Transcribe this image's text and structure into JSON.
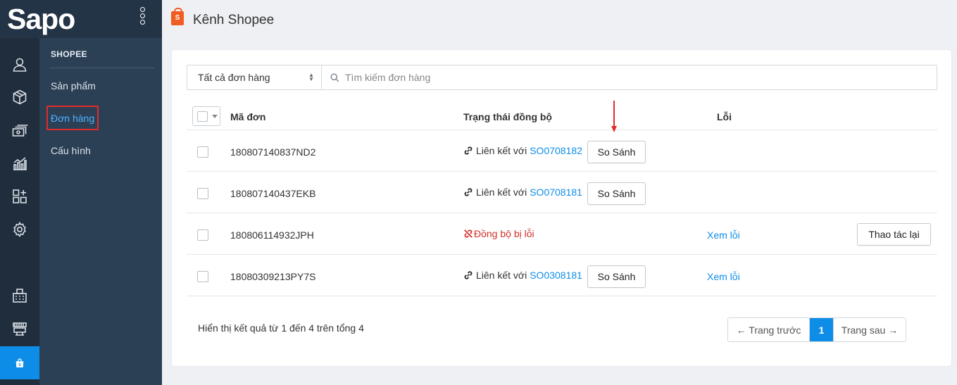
{
  "app": {
    "logo_text": "Sapo"
  },
  "sidebar": {
    "section_title": "SHOPEE",
    "items": [
      {
        "label": "Sản phẩm"
      },
      {
        "label": "Đơn hàng"
      },
      {
        "label": "Cấu hình"
      }
    ]
  },
  "rail": {
    "icons": [
      "user-icon",
      "box-icon",
      "money-icon",
      "chart-icon",
      "apps-icon",
      "gear-icon",
      "pos-register-icon",
      "store-icon",
      "shopee-bag-icon"
    ]
  },
  "header": {
    "title": "Kênh Shopee",
    "icon_glyph": "S"
  },
  "filter": {
    "select_value": "Tất cả đơn hàng",
    "search_placeholder": "Tìm kiếm đơn hàng"
  },
  "table": {
    "headers": {
      "code": "Mã đơn",
      "sync_status": "Trạng thái đồng bộ",
      "error": "Lỗi"
    },
    "link_prefix": "Liên kết với",
    "compare_label": "So Sánh",
    "view_error_label": "Xem lỗi",
    "retry_label": "Thao tác lại",
    "rows": [
      {
        "code": "180807140837ND2",
        "status": "linked",
        "linked_order": "SO0708182"
      },
      {
        "code": "180807140437EKB",
        "status": "linked",
        "linked_order": "SO0708181"
      },
      {
        "code": "180806114932JPH",
        "status": "error",
        "status_text": "Đồng bộ bị lỗi"
      },
      {
        "code": "18080309213PY7S",
        "status": "linked",
        "linked_order": "SO0308181"
      }
    ]
  },
  "footer": {
    "summary": "Hiển thị kết quả từ 1 đến 4 trên tổng 4",
    "prev_label": "← Trang trước",
    "current_page": "1",
    "next_label": "Trang sau →"
  },
  "colors": {
    "accent": "#0d8de8",
    "error": "#d0302a",
    "annotation": "#e32b2b",
    "sidebar_dark": "#1f2d3d",
    "sidebar_sub": "#2b3f55"
  }
}
